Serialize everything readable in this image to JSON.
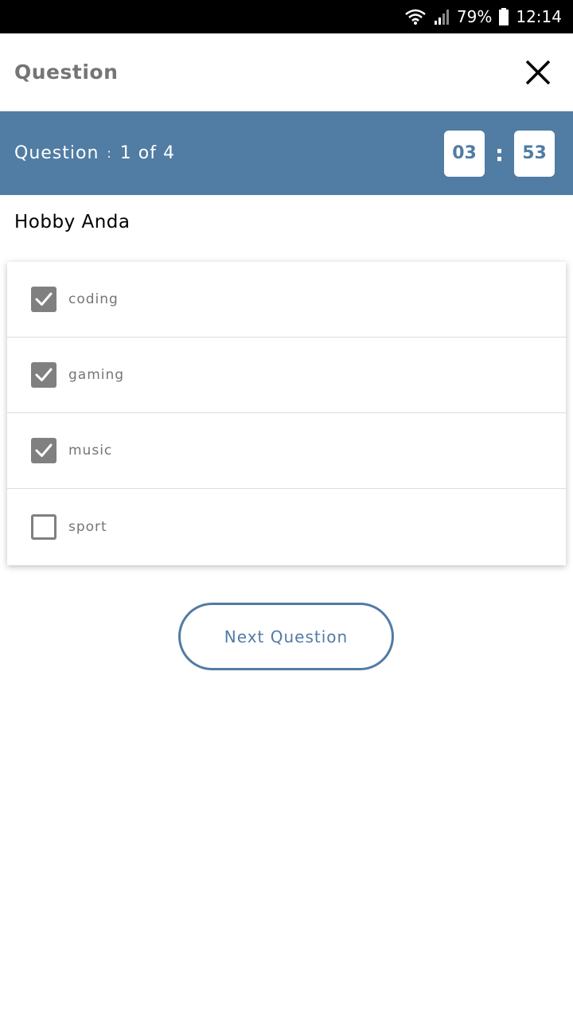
{
  "status_bar": {
    "battery_percent": "79%",
    "time": "12:14",
    "icons": [
      "wifi-icon",
      "signal-icon",
      "battery-icon"
    ]
  },
  "app_bar": {
    "title": "Question",
    "close_icon": "close-icon"
  },
  "question_header": {
    "label": "Question",
    "separator": ":",
    "progress": "1 of 4",
    "timer": {
      "minutes": "03",
      "colon": ":",
      "seconds": "53"
    }
  },
  "question": {
    "text": "Hobby Anda",
    "options": [
      {
        "label": "coding",
        "checked": true
      },
      {
        "label": "gaming",
        "checked": true
      },
      {
        "label": "music",
        "checked": true
      },
      {
        "label": "sport",
        "checked": false
      }
    ]
  },
  "actions": {
    "next_label": "Next Question"
  },
  "colors": {
    "accent": "#517ca3",
    "checkbox": "#808080",
    "status_bar": "#000000"
  }
}
